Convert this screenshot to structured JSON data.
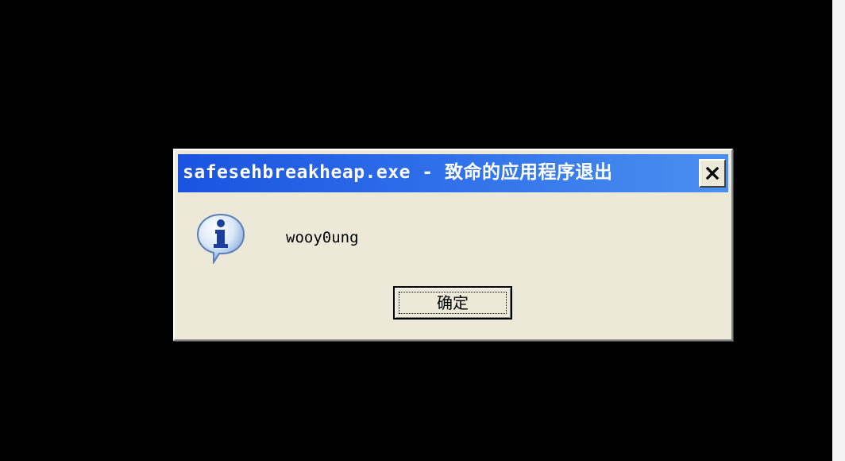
{
  "dialog": {
    "title": "safesehbreakheap.exe - 致命的应用程序退出",
    "message": "wooy0ung",
    "ok_label": "确定",
    "icon": "information-icon",
    "close_icon": "close-icon"
  },
  "colors": {
    "desktop": "#000000",
    "titlebar_start": "#1a53e0",
    "titlebar_end": "#4a90f0",
    "dialog_face": "#ece9d8"
  }
}
